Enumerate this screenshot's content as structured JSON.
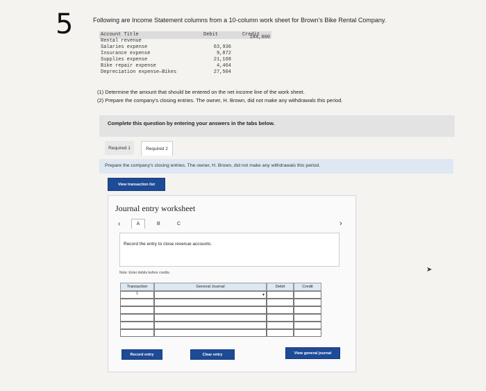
{
  "question_number": "5",
  "intro_text": "Following are Income Statement columns from a 10-column work sheet for Brown's Bike Rental Company.",
  "worksheet_table": {
    "headers": {
      "account": "Account Title",
      "debit": "Debit",
      "credit": "Credit"
    },
    "rows": [
      {
        "account": "Rental revenue",
        "debit": "",
        "credit": "144,000"
      },
      {
        "account": "Salaries expense",
        "debit": "63,936",
        "credit": ""
      },
      {
        "account": "Insurance expense",
        "debit": "9,872",
        "credit": ""
      },
      {
        "account": "Supplies expense",
        "debit": "21,168",
        "credit": ""
      },
      {
        "account": "Bike repair expense",
        "debit": "4,464",
        "credit": ""
      },
      {
        "account": "Depreciation expense—Bikes",
        "debit": "27,504",
        "credit": ""
      }
    ]
  },
  "instructions": [
    "(1) Determine the amount that should be entered on the net income line of the work sheet.",
    "(2) Prepare the company's closing entries. The owner, H. Brown, did not make any withdrawals this period."
  ],
  "complete_text": "Complete this question by entering your answers in the tabs below.",
  "tabs": [
    {
      "label": "Required 1"
    },
    {
      "label": "Required 2"
    }
  ],
  "prepare_text": "Prepare the company's closing entries. The owner, H. Brown, did not make any withdrawals this period.",
  "view_transaction_label": "View transaction list",
  "journal": {
    "title": "Journal entry worksheet",
    "letters": [
      "A",
      "B",
      "C"
    ],
    "record_instruction": "Record the entry to close revenue accounts.",
    "note": "Note: Enter debits before credits.",
    "columns": {
      "transaction": "Transaction",
      "general_journal": "General Journal",
      "debit": "Debit",
      "credit": "Credit"
    },
    "transaction_number": "1",
    "buttons": {
      "record": "Record entry",
      "clear": "Clear entry",
      "view_journal": "View general journal"
    }
  },
  "colors": {
    "button_blue": "#1e4b96",
    "header_blue": "#dde8f2"
  }
}
